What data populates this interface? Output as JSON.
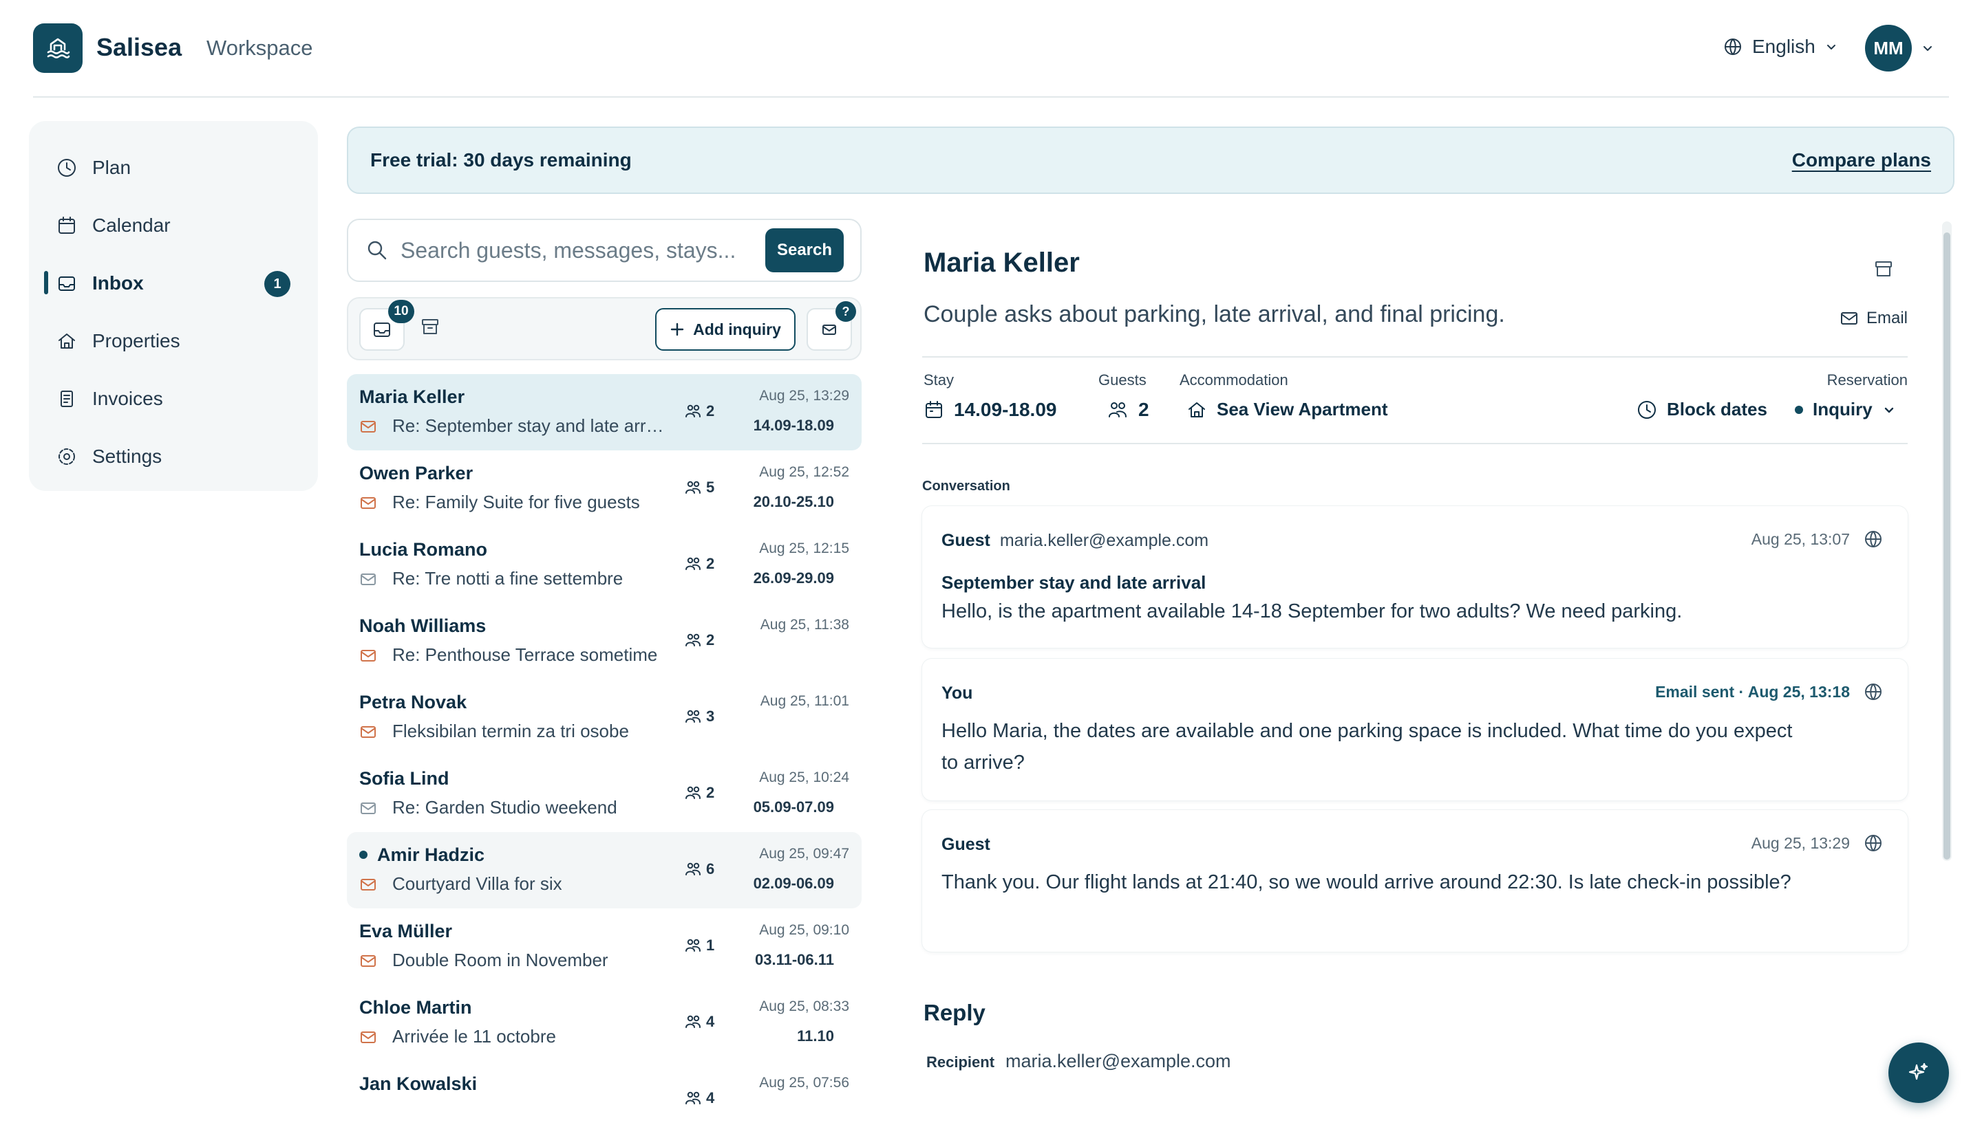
{
  "header": {
    "brand": "Salisea",
    "workspace": "Workspace",
    "language": "English",
    "avatar_initials": "MM"
  },
  "sidebar": {
    "items": [
      {
        "label": "Plan",
        "icon": "clock-icon"
      },
      {
        "label": "Calendar",
        "icon": "calendar-icon"
      },
      {
        "label": "Inbox",
        "icon": "inbox-icon",
        "badge": "1",
        "active": true
      },
      {
        "label": "Properties",
        "icon": "home-icon"
      },
      {
        "label": "Invoices",
        "icon": "receipt-icon"
      },
      {
        "label": "Settings",
        "icon": "gear-icon"
      }
    ]
  },
  "trial": {
    "text": "Free trial: 30 days remaining",
    "link": "Compare plans"
  },
  "search": {
    "placeholder": "Search guests, messages, stays...",
    "button": "Search"
  },
  "toolbar": {
    "inbox_count": "10",
    "add_inquiry": "Add inquiry",
    "help": "?"
  },
  "inquiries": [
    {
      "name": "Maria Keller",
      "subject": "Re: September stay and late arrival",
      "guests": "2",
      "time": "Aug 25, 13:29",
      "dates": "14.09-18.09"
    },
    {
      "name": "Owen Parker",
      "subject": "Re: Family Suite for five guests",
      "guests": "5",
      "time": "Aug 25, 12:52",
      "dates": "20.10-25.10"
    },
    {
      "name": "Lucia Romano",
      "subject": "Re: Tre notti a fine settembre",
      "guests": "2",
      "time": "Aug 25, 12:15",
      "dates": "26.09-29.09"
    },
    {
      "name": "Noah Williams",
      "subject": "Re: Penthouse Terrace sometime",
      "guests": "2",
      "time": "Aug 25, 11:38",
      "dates": ""
    },
    {
      "name": "Petra Novak",
      "subject": "Fleksibilan termin za tri osobe",
      "guests": "3",
      "time": "Aug 25, 11:01",
      "dates": ""
    },
    {
      "name": "Sofia Lind",
      "subject": "Re: Garden Studio weekend",
      "guests": "2",
      "time": "Aug 25, 10:24",
      "dates": "05.09-07.09"
    },
    {
      "name": "Amir Hadzic",
      "subject": "Courtyard Villa for six",
      "guests": "6",
      "time": "Aug 25, 09:47",
      "dates": "02.09-06.09"
    },
    {
      "name": "Eva Müller",
      "subject": "Double Room in November",
      "guests": "1",
      "time": "Aug 25, 09:10",
      "dates": "03.11-06.11"
    },
    {
      "name": "Chloe Martin",
      "subject": "Arrivée le 11 octobre",
      "guests": "4",
      "time": "Aug 25, 08:33",
      "dates": "11.10"
    },
    {
      "name": "Jan Kowalski",
      "subject": "",
      "guests": "4",
      "time": "Aug 25, 07:56",
      "dates": ""
    }
  ],
  "detail": {
    "name": "Maria Keller",
    "summary": "Couple asks about parking, late arrival, and final pricing.",
    "email_label": "Email",
    "stay_label": "Stay",
    "stay": "14.09-18.09",
    "guests_label": "Guests",
    "guests": "2",
    "accommodation_label": "Accommodation",
    "accommodation": "Sea View Apartment",
    "block_dates": "Block dates",
    "reservation_label": "Reservation",
    "reservation_status": "Inquiry",
    "conversation_label": "Conversation",
    "messages": [
      {
        "author": "Guest",
        "from": "maria.keller@example.com",
        "meta": "Aug 25, 13:07",
        "subject": "September stay and late arrival",
        "body": "Hello, is the apartment available 14-18 September for two adults? We need parking."
      },
      {
        "author": "You",
        "from": "",
        "meta": "Email sent · Aug 25, 13:18",
        "subject": "",
        "body": "Hello Maria, the dates are available and one parking space is included. What time do you expect to arrive?"
      },
      {
        "author": "Guest",
        "from": "",
        "meta": "Aug 25, 13:29",
        "subject": "",
        "body": "Thank you. Our flight lands at 21:40, so we would arrive around 22:30. Is late check-in possible?"
      }
    ],
    "reply_title": "Reply",
    "recipient_label": "Recipient",
    "recipient": "maria.keller@example.com"
  },
  "colors": {
    "accent": "#114b5f",
    "selected_row": "#e1eff3",
    "mail_icon_orange": "#d0734a",
    "banner": "#e7f3f6"
  }
}
